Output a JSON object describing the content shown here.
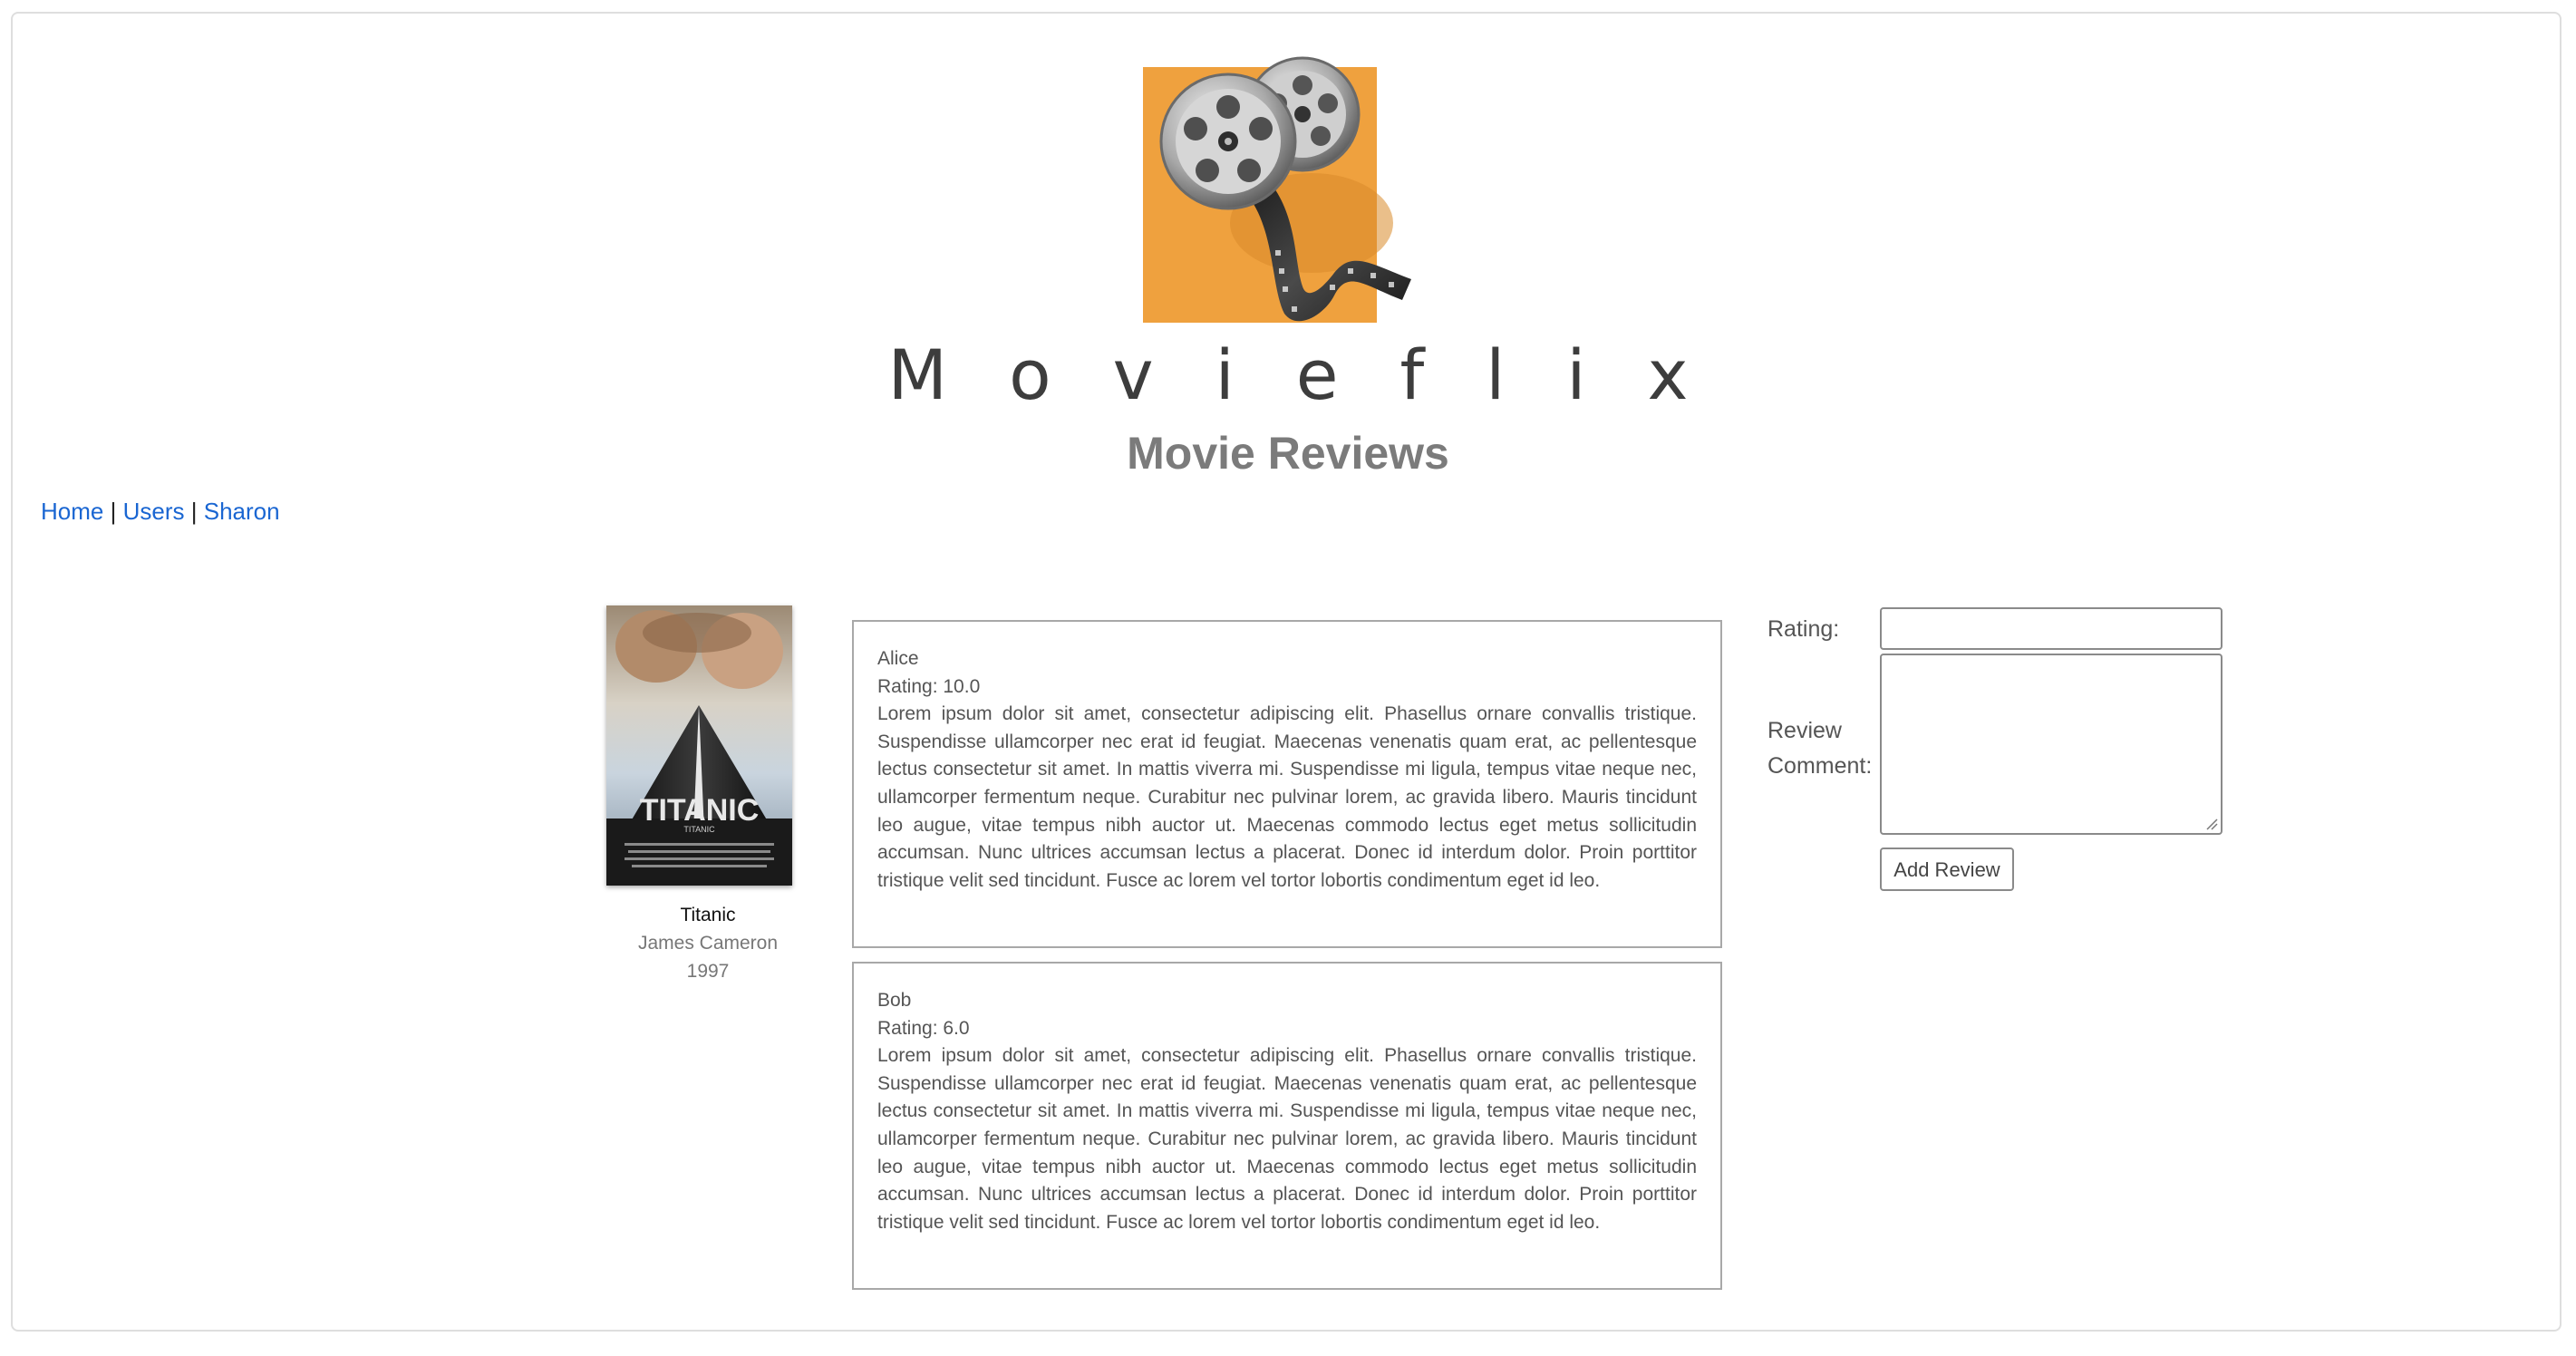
{
  "header": {
    "brand": "Movieflix",
    "subtitle": "Movie Reviews"
  },
  "nav": {
    "links": [
      {
        "label": "Home"
      },
      {
        "label": "Users"
      },
      {
        "label": "Sharon"
      }
    ],
    "separator": "|"
  },
  "movie": {
    "title": "Titanic",
    "director": "James Cameron",
    "year": "1997",
    "poster_text": "TITANIC"
  },
  "reviews": [
    {
      "author": "Alice",
      "rating": "Rating: 10.0",
      "text": "Lorem ipsum dolor sit amet, consectetur adipiscing elit. Phasellus ornare convallis tristique. Suspendisse ullamcorper nec erat id feugiat. Maecenas venenatis quam erat, ac pellentesque lectus consectetur sit amet. In mattis viverra mi. Suspendisse mi ligula, tempus vitae neque nec, ullamcorper fermentum neque. Curabitur nec pulvinar lorem, ac gravida libero. Mauris tincidunt leo augue, vitae tempus nibh auctor ut. Maecenas commodo lectus eget metus sollicitudin accumsan. Nunc ultrices accumsan lectus a placerat. Donec id interdum dolor. Proin porttitor tristique velit sed tincidunt. Fusce ac lorem vel tortor lobortis condimentum eget id leo."
    },
    {
      "author": "Bob",
      "rating": "Rating: 6.0",
      "text": "Lorem ipsum dolor sit amet, consectetur adipiscing elit. Phasellus ornare convallis tristique. Suspendisse ullamcorper nec erat id feugiat. Maecenas venenatis quam erat, ac pellentesque lectus consectetur sit amet. In mattis viverra mi. Suspendisse mi ligula, tempus vitae neque nec, ullamcorper fermentum neque. Curabitur nec pulvinar lorem, ac gravida libero. Mauris tincidunt leo augue, vitae tempus nibh auctor ut. Maecenas commodo lectus eget metus sollicitudin accumsan. Nunc ultrices accumsan lectus a placerat. Donec id interdum dolor. Proin porttitor tristique velit sed tincidunt. Fusce ac lorem vel tortor lobortis condimentum eget id leo."
    }
  ],
  "form": {
    "rating_label": "Rating:",
    "comment_label_line1": "Review",
    "comment_label_line2": "Comment:",
    "rating_value": "",
    "comment_value": "",
    "submit_label": "Add Review"
  },
  "colors": {
    "link": "#1a66d2",
    "logo_background": "#efa13e",
    "heading_gray": "#7b7b7b"
  },
  "icons": {
    "logo": "film-reel-icon",
    "poster": "movie-poster-image"
  }
}
